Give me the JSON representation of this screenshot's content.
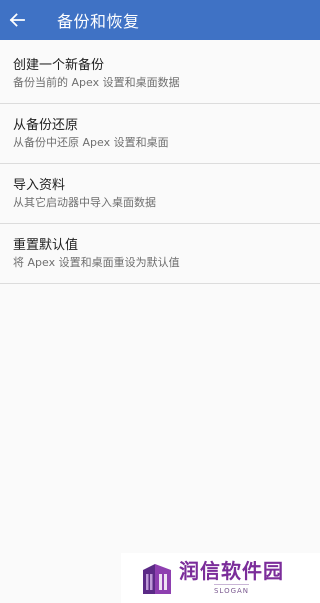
{
  "app_bar": {
    "title": "备份和恢复",
    "background_color": "#3f72c5",
    "back_icon": "arrow-left-icon"
  },
  "items": [
    {
      "title": "创建一个新备份",
      "subtitle": "备份当前的 Apex 设置和桌面数据"
    },
    {
      "title": "从备份还原",
      "subtitle": "从备份中还原 Apex 设置和桌面"
    },
    {
      "title": "导入资料",
      "subtitle": "从其它启动器中导入桌面数据"
    },
    {
      "title": "重置默认值",
      "subtitle": "将 Apex 设置和桌面重设为默认值"
    }
  ],
  "watermark": {
    "name": "润信软件园",
    "slogan": "SLOGAN",
    "color": "#7b2d9a"
  }
}
